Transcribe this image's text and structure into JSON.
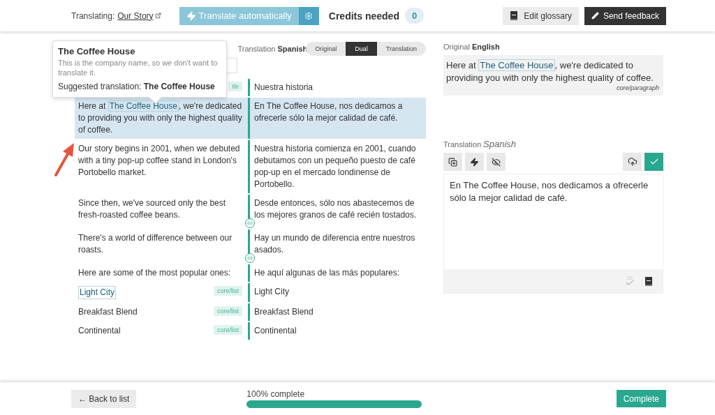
{
  "header": {
    "translating_label": "Translating:",
    "document_link": "Our Story",
    "translate_button": "Translate automatically",
    "credits_label": "Credits needed",
    "credits_count": "0",
    "glossary_button": "Edit glossary",
    "feedback_button": "Send feedback"
  },
  "view": {
    "translation_label": "Translation",
    "translation_language": "Spanish",
    "modes": [
      {
        "label": "Original",
        "selected": false
      },
      {
        "label": "Dual",
        "selected": true
      },
      {
        "label": "Translation",
        "selected": false
      }
    ]
  },
  "tooltip": {
    "title": "The Coffee House",
    "note": "This is the company name, so we don't want to translate it.",
    "suggestion_label": "Suggested translation:",
    "suggestion": "The Coffee House"
  },
  "rows": [
    {
      "tag": "tle",
      "target": "Nuestra historia",
      "selected": false,
      "linked": false
    },
    {
      "source_before": "Here at ",
      "source_term": "The Coffee House",
      "source_after": ", we're dedicated to providing you with only the highest quality of coffee.",
      "target": "En The Coffee House, nos dedicamos a ofrecerle sólo la mejor calidad de café.",
      "selected": true,
      "linked": false
    },
    {
      "source_before": "Our story begins in 2001, when we debuted with a tiny pop-up coffee stand in London's Portobello market.",
      "target": "Nuestra historia comienza en 2001, cuando debutamos con un pequeño puesto de café pop-up en el mercado londinense de Portobello.",
      "selected": false,
      "linked": false
    },
    {
      "source_before": "Since then, we've sourced only the best fresh-roasted coffee beans.",
      "target": "Desde entonces, sólo nos abastecemos de los mejores granos de café recién tostados.",
      "selected": false,
      "linked": true
    },
    {
      "source_before": "There's a world of difference between our roasts.",
      "target": "Hay un mundo de diferencia entre nuestros asados.",
      "selected": false,
      "linked": true
    },
    {
      "source_before": "Here are some of the most popular ones:",
      "target": "He aquí algunas de las más populares:",
      "selected": false,
      "linked": false
    },
    {
      "source_term": "Light City",
      "tag": "core/list",
      "target": "Light City",
      "selected": false,
      "linked": false
    },
    {
      "source_before": "Breakfast Blend",
      "tag": "core/list",
      "target": "Breakfast Blend",
      "selected": false,
      "linked": false
    },
    {
      "source_before": "Continental",
      "tag": "core/list",
      "target": "Continental",
      "selected": false,
      "linked": false
    }
  ],
  "editor": {
    "original_label": "Original",
    "original_language": "English",
    "original_before": "Here at ",
    "original_term": "The Coffee House",
    "original_after": ", we're dedicated to providing you with only the highest quality of coffee.",
    "block_type": "core/paragraph",
    "translation_label": "Translation",
    "translation_language": "Spanish",
    "value": "En The Coffee House, nos dedicamos a ofrecerle sólo la mejor calidad de café."
  },
  "footer": {
    "back_button": "← Back to list",
    "progress_label": "100% complete",
    "level": 1,
    "complete_button": "Complete"
  }
}
